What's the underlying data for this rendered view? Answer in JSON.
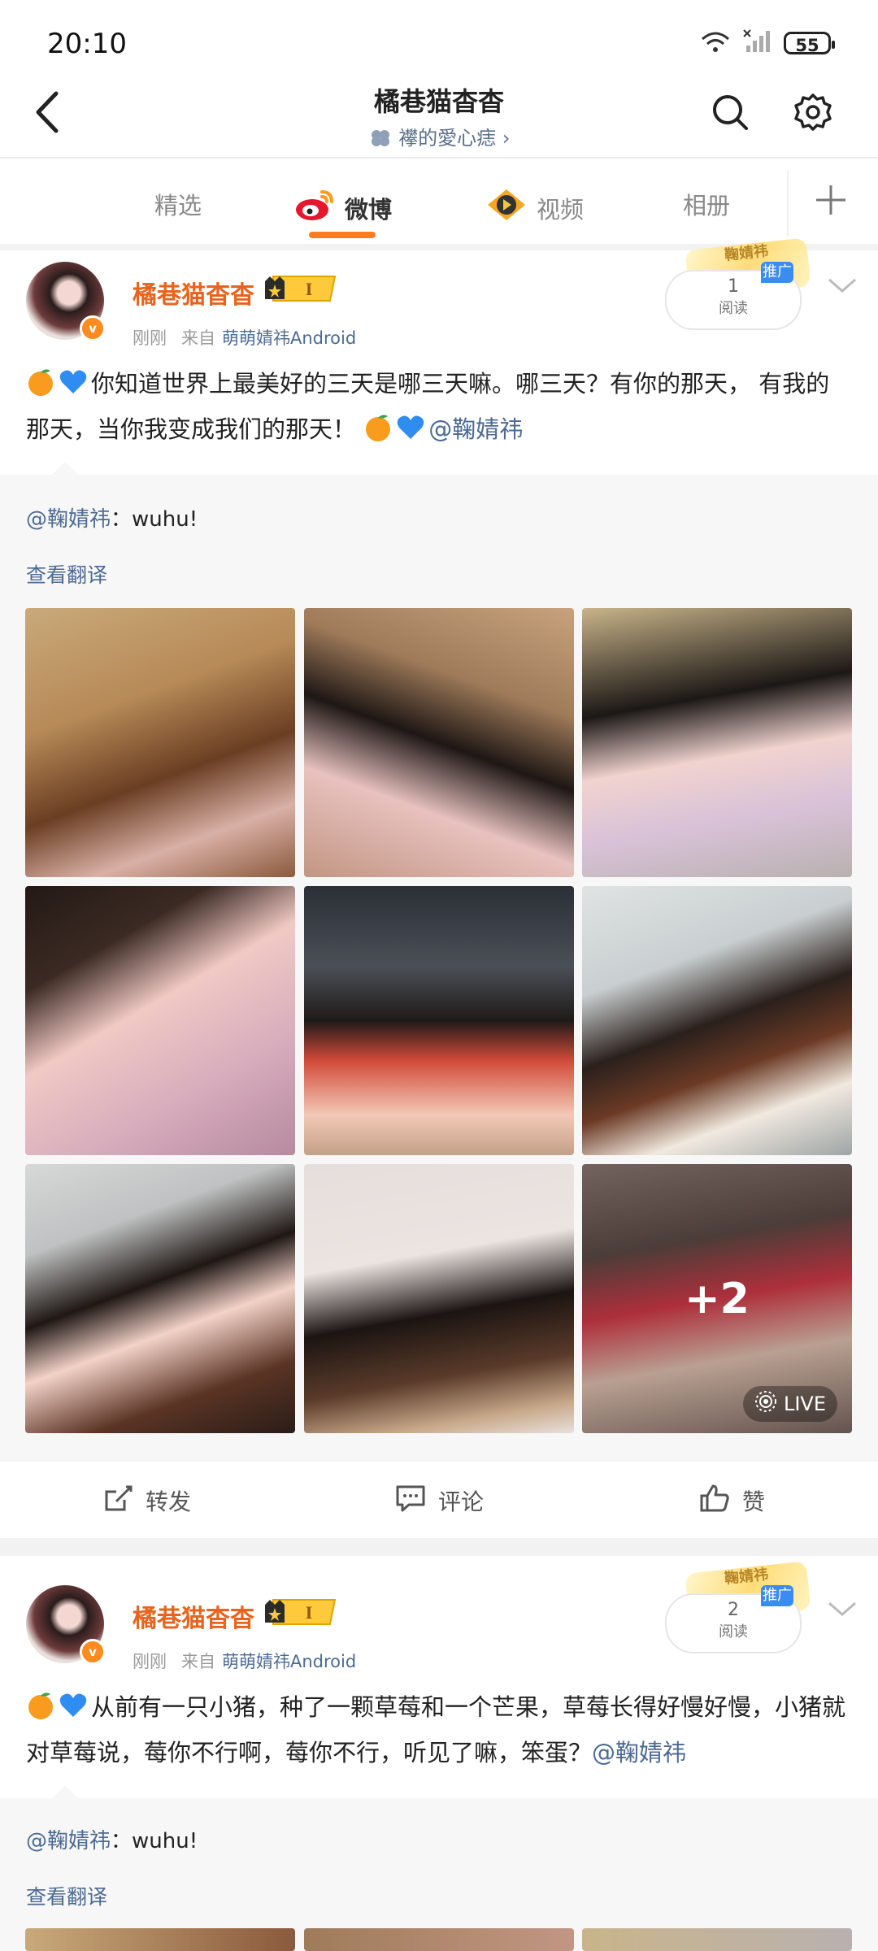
{
  "status": {
    "time": "20:10",
    "battery": "55"
  },
  "header": {
    "title": "橘巷猫杳杳",
    "subtitle": "襻的愛心痣"
  },
  "tabs": [
    {
      "label": "精选"
    },
    {
      "label": "微博"
    },
    {
      "label": "视频"
    },
    {
      "label": "相册"
    }
  ],
  "posts": [
    {
      "author": "橘巷猫杳杳",
      "level": "I",
      "time": "刚刚",
      "from_label": "来自",
      "source": "萌萌婧祎Android",
      "read_count": "1",
      "read_label": "阅读",
      "promo": "推广",
      "promo_stamp": "鞠婧祎",
      "text": "你知道世界上最美好的三天是哪三天嘛。哪三天？有你的那天， 有我的那天，当你我变成我们的那天！",
      "mention": "@鞠婧祎",
      "forward_mention": "@鞠婧祎",
      "forward_text": "：wuhu!",
      "translate": "查看翻译",
      "extra_photos": "+2",
      "live": "LIVE",
      "actions": {
        "repost": "转发",
        "comment": "评论",
        "like": "赞"
      }
    },
    {
      "author": "橘巷猫杳杳",
      "level": "I",
      "time": "刚刚",
      "from_label": "来自",
      "source": "萌萌婧祎Android",
      "read_count": "2",
      "read_label": "阅读",
      "promo": "推广",
      "promo_stamp": "鞠婧祎",
      "text": "从前有一只小猪，种了一颗草莓和一个芒果，草莓长得好慢好慢，小猪就对草莓说，莓你不行啊，莓你不行，听见了嘛，笨蛋？",
      "mention": "@鞠婧祎",
      "forward_mention": "@鞠婧祎",
      "forward_text": "：wuhu!",
      "translate": "查看翻译"
    }
  ],
  "colors": {
    "accent": "#ff7c1c",
    "author": "#e8641e",
    "link": "#4c6a94",
    "promo": "#3b8cf0"
  }
}
